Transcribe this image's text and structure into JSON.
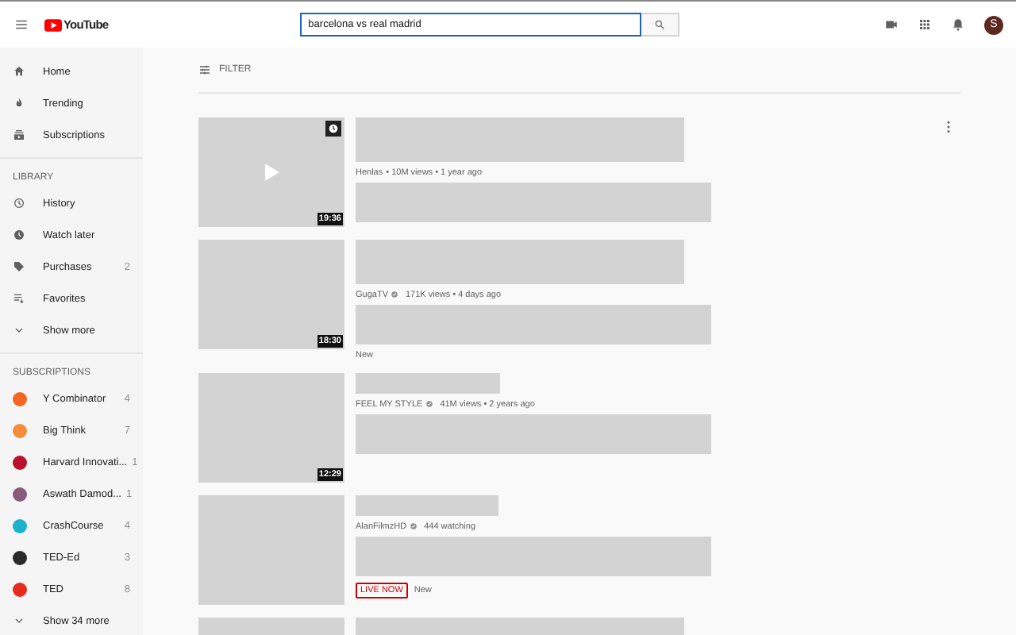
{
  "header": {
    "logo": "YouTube",
    "search": {
      "value": "barcelona vs real madrid"
    },
    "avatar": "S"
  },
  "sidebar": {
    "main": [
      {
        "label": "Home"
      },
      {
        "label": "Trending"
      },
      {
        "label": "Subscriptions"
      }
    ],
    "library_heading": "LIBRARY",
    "library": [
      {
        "label": "History"
      },
      {
        "label": "Watch later"
      },
      {
        "label": "Purchases",
        "count": "2"
      },
      {
        "label": "Favorites"
      },
      {
        "label": "Show more"
      }
    ],
    "subscriptions_heading": "SUBSCRIPTIONS",
    "subscriptions": [
      {
        "label": "Y Combinator",
        "count": "4",
        "color": "#f26522"
      },
      {
        "label": "Big Think",
        "count": "7",
        "color": "#f58b3c"
      },
      {
        "label": "Harvard Innovati...",
        "count": "1",
        "color": "#b8112b"
      },
      {
        "label": "Aswath Damod...",
        "count": "1",
        "color": "#8a5a7a"
      },
      {
        "label": "CrashCourse",
        "count": "4",
        "color": "#1bb3c9"
      },
      {
        "label": "TED-Ed",
        "count": "3",
        "color": "#2a2a2a"
      },
      {
        "label": "TED",
        "count": "8",
        "color": "#e62b1e"
      }
    ],
    "show_more": "Show 34 more"
  },
  "filter": "FILTER",
  "videos": [
    {
      "kind": "video",
      "duration": "19:36",
      "watch_later": true,
      "play": true,
      "menu": true,
      "channel": "Henlas",
      "verified": false,
      "stats": "• 10M views • 1 year ago"
    },
    {
      "kind": "video",
      "duration": "18:30",
      "watch_later": false,
      "play": false,
      "menu": false,
      "channel": "GugaTV",
      "verified": true,
      "stats": "171K views • 4 days ago",
      "badges": [
        {
          "kind": "new",
          "label": "New"
        }
      ]
    },
    {
      "kind": "video",
      "duration": "12:29",
      "watch_later": false,
      "play": false,
      "menu": false,
      "channel": "FEEL MY STYLE",
      "verified": true,
      "stats": "41M views • 2 years ago"
    },
    {
      "kind": "video",
      "watch_later": false,
      "play": false,
      "menu": false,
      "channel": "AlanFilmzHD",
      "verified": true,
      "stats": "444 watching",
      "badges": [
        {
          "kind": "live",
          "label": "LIVE NOW"
        },
        {
          "kind": "new",
          "label": "New"
        }
      ]
    },
    {
      "kind": "partial"
    }
  ]
}
